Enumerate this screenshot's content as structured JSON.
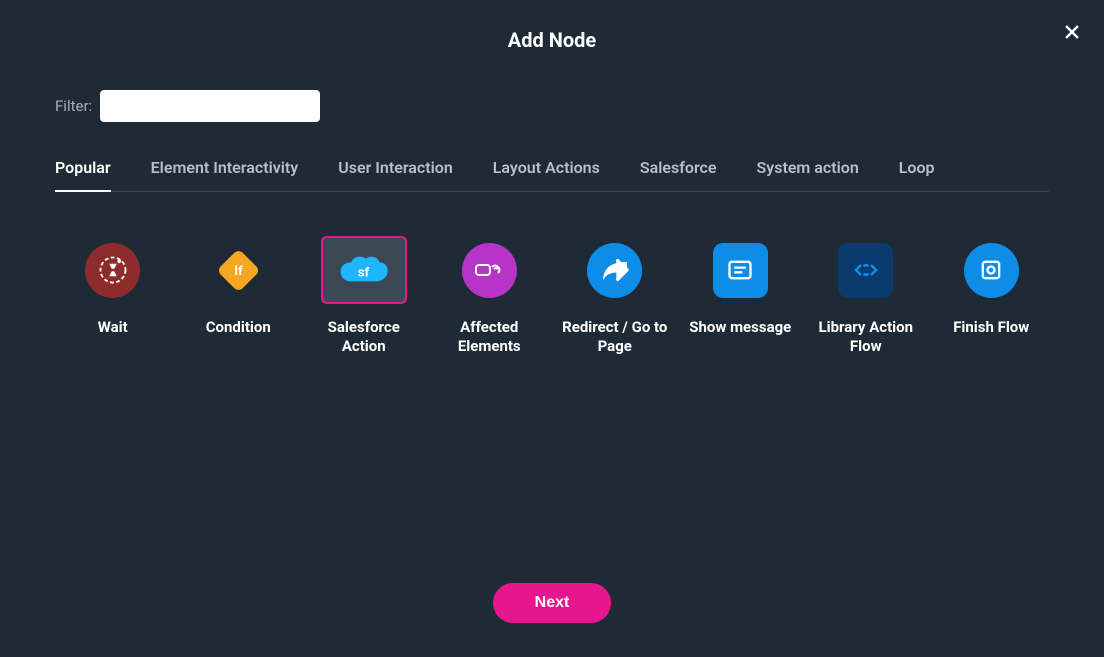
{
  "title": "Add Node",
  "filter": {
    "label": "Filter:",
    "value": ""
  },
  "tabs": [
    {
      "label": "Popular",
      "active": true
    },
    {
      "label": "Element Interactivity",
      "active": false
    },
    {
      "label": "User Interaction",
      "active": false
    },
    {
      "label": "Layout Actions",
      "active": false
    },
    {
      "label": "Salesforce",
      "active": false
    },
    {
      "label": "System action",
      "active": false
    },
    {
      "label": "Loop",
      "active": false
    }
  ],
  "nodes": [
    {
      "key": "wait",
      "label": "Wait",
      "icon": "hourglass-icon",
      "selected": false
    },
    {
      "key": "condition",
      "label": "Condition",
      "icon": "diamond-if-icon",
      "selected": false
    },
    {
      "key": "salesforce-action",
      "label": "Salesforce Action",
      "icon": "cloud-sf-icon",
      "selected": true
    },
    {
      "key": "affected-elements",
      "label": "Affected Elements",
      "icon": "hand-icon",
      "selected": false
    },
    {
      "key": "redirect",
      "label": "Redirect / Go to Page",
      "icon": "share-arrow-icon",
      "selected": false
    },
    {
      "key": "show-message",
      "label": "Show message",
      "icon": "message-icon",
      "selected": false
    },
    {
      "key": "library-action-flow",
      "label": "Library Action Flow",
      "icon": "code-refresh-icon",
      "selected": false
    },
    {
      "key": "finish-flow",
      "label": "Finish Flow",
      "icon": "finish-flag-icon",
      "selected": false
    }
  ],
  "footer": {
    "next_label": "Next"
  }
}
